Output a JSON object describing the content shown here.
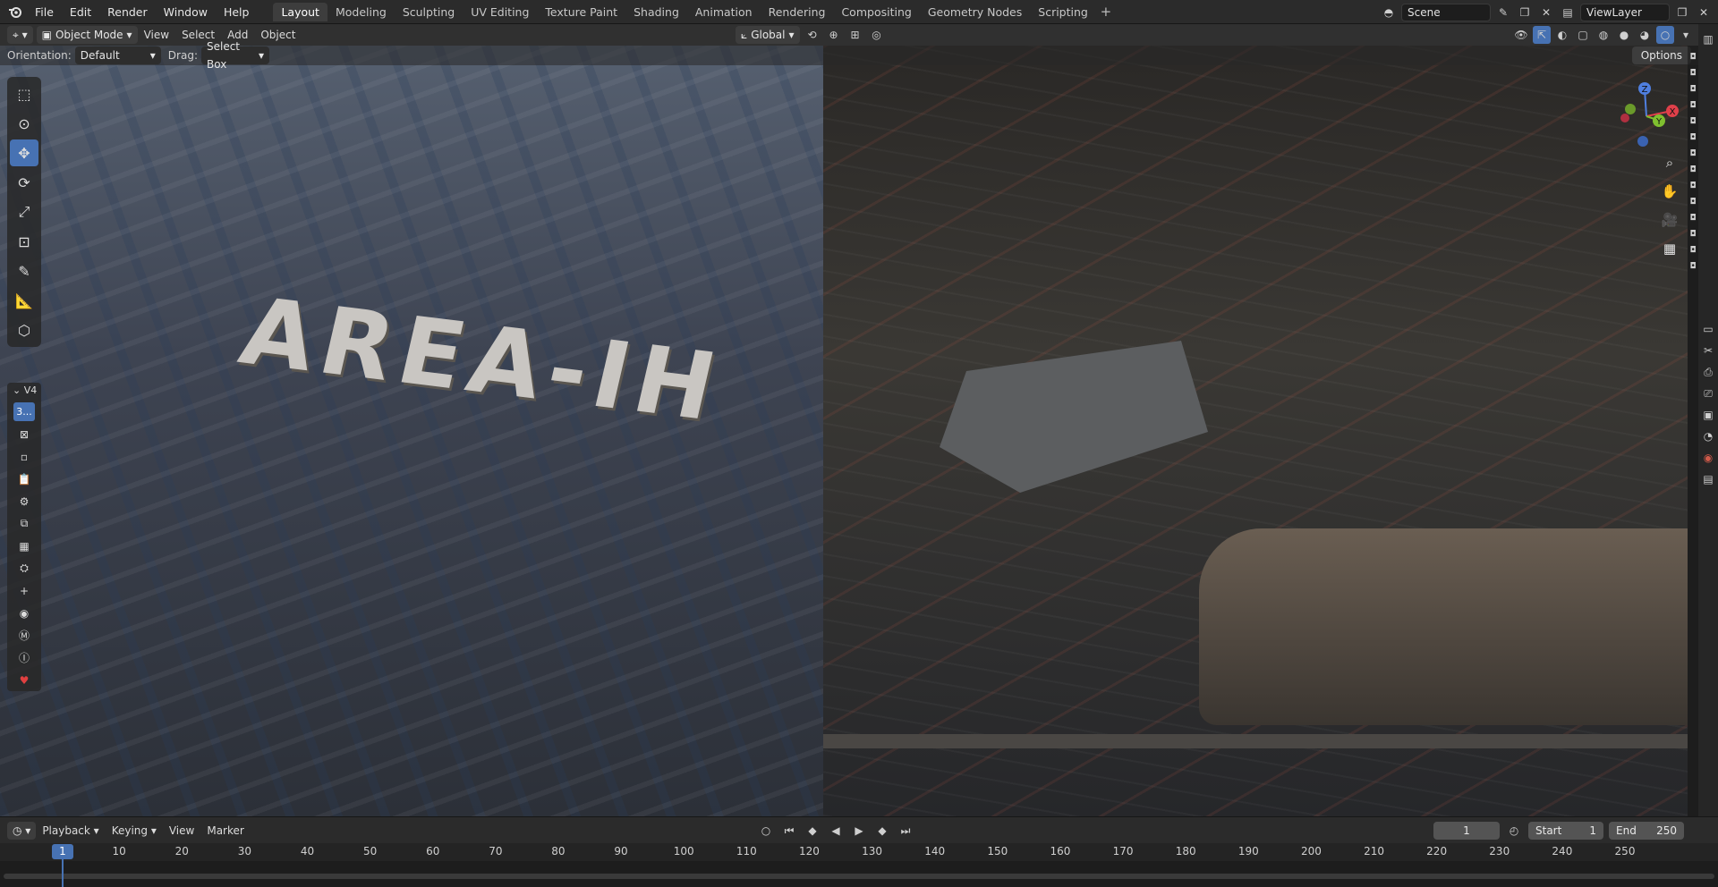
{
  "menu": [
    "File",
    "Edit",
    "Render",
    "Window",
    "Help"
  ],
  "workspaces": [
    "Layout",
    "Modeling",
    "Sculpting",
    "UV Editing",
    "Texture Paint",
    "Shading",
    "Animation",
    "Rendering",
    "Compositing",
    "Geometry Nodes",
    "Scripting"
  ],
  "active_workspace": "Layout",
  "scene": "Scene",
  "view_layer": "ViewLayer",
  "viewport_header": {
    "mode": "Object Mode",
    "menus": [
      "View",
      "Select",
      "Add",
      "Object"
    ],
    "transform_orientation": "Global"
  },
  "tool_header": {
    "orientation_label": "Orientation:",
    "orientation_value": "Default",
    "drag_label": "Drag:",
    "drag_value": "Select Box",
    "options": "Options"
  },
  "scene_sign_text": "AREA-IH",
  "addon_panel": {
    "header": "V4",
    "first_button": "3..."
  },
  "gizmo": {
    "x": "X",
    "y": "Y",
    "z": "Z"
  },
  "timeline": {
    "menus": [
      "Playback",
      "Keying",
      "View",
      "Marker"
    ],
    "current_frame": "1",
    "start_label": "Start",
    "start_value": "1",
    "end_label": "End",
    "end_value": "250",
    "ticks": [
      "1",
      "10",
      "20",
      "30",
      "40",
      "50",
      "60",
      "70",
      "80",
      "90",
      "100",
      "110",
      "120",
      "130",
      "140",
      "150",
      "160",
      "170",
      "180",
      "190",
      "200",
      "210",
      "220",
      "230",
      "240",
      "250"
    ]
  },
  "colors": {
    "accent": "#4772b3",
    "header": "#303030",
    "topbar": "#2b2b2b"
  }
}
